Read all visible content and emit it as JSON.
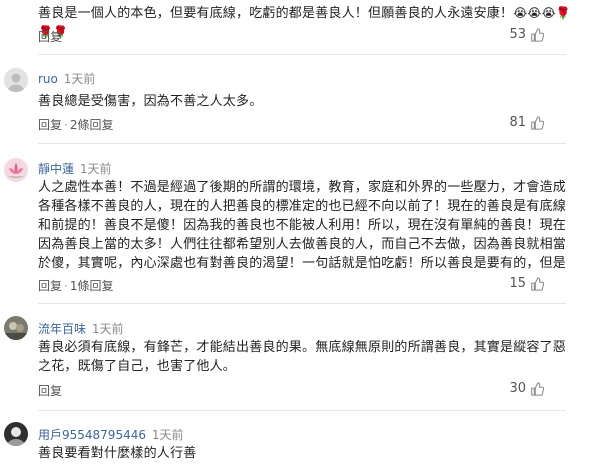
{
  "comments": [
    {
      "username": "",
      "time": "",
      "text": "善良是一個人的本色，但要有底線，吃虧的都是善良人！但願善良的人永遠安康！",
      "emojis": "😭😭😭🌹🌹🌹",
      "actions": [
        "回复"
      ],
      "likes": "53"
    },
    {
      "username": "ruo",
      "time": "1天前",
      "text": "善良總是受傷害，因為不善之人太多。",
      "actions": [
        "回复",
        "2條回复"
      ],
      "likes": "81"
    },
    {
      "username": "靜中蓮",
      "time": "1天前",
      "text": "人之處性本善！不過是經過了後期的所謂的環境，教育，家庭和外界的一些壓力，才會造成各種各樣不善良的人，現在的人把善良的標准定的也已經不向以前了！現在的善良是有底線和前提的！善良不是傻！因為我的善良也不能被人利用！所以，現在沒有單純的善良！現在因為善良上當的太多！人們往往都希望別人去做善良的人，而自己不去做，因為善良就相當於傻，其實呢，內心深處也有對善良的渴望！一句話就是怕吃虧！所以善良是要有的，但是要有底心！",
      "actions": [
        "回复",
        "1條回复"
      ],
      "likes": "15"
    },
    {
      "username": "流年百味",
      "time": "1天前",
      "text": "善良必須有底線，有鋒芒，才能結出善良的果。無底線無原則的所謂善良，其實是縱容了惡之花，既傷了自己，也害了他人。",
      "actions": [
        "回复"
      ],
      "likes": "30"
    },
    {
      "username": "用戶95548795446",
      "time": "1天前",
      "text": "善良要看對什麼樣的人行善",
      "actions": [],
      "likes": ""
    }
  ],
  "colors": {
    "username": "#406599",
    "time": "#8a8a8a",
    "text": "#222222",
    "divider": "#e6e6e6"
  }
}
